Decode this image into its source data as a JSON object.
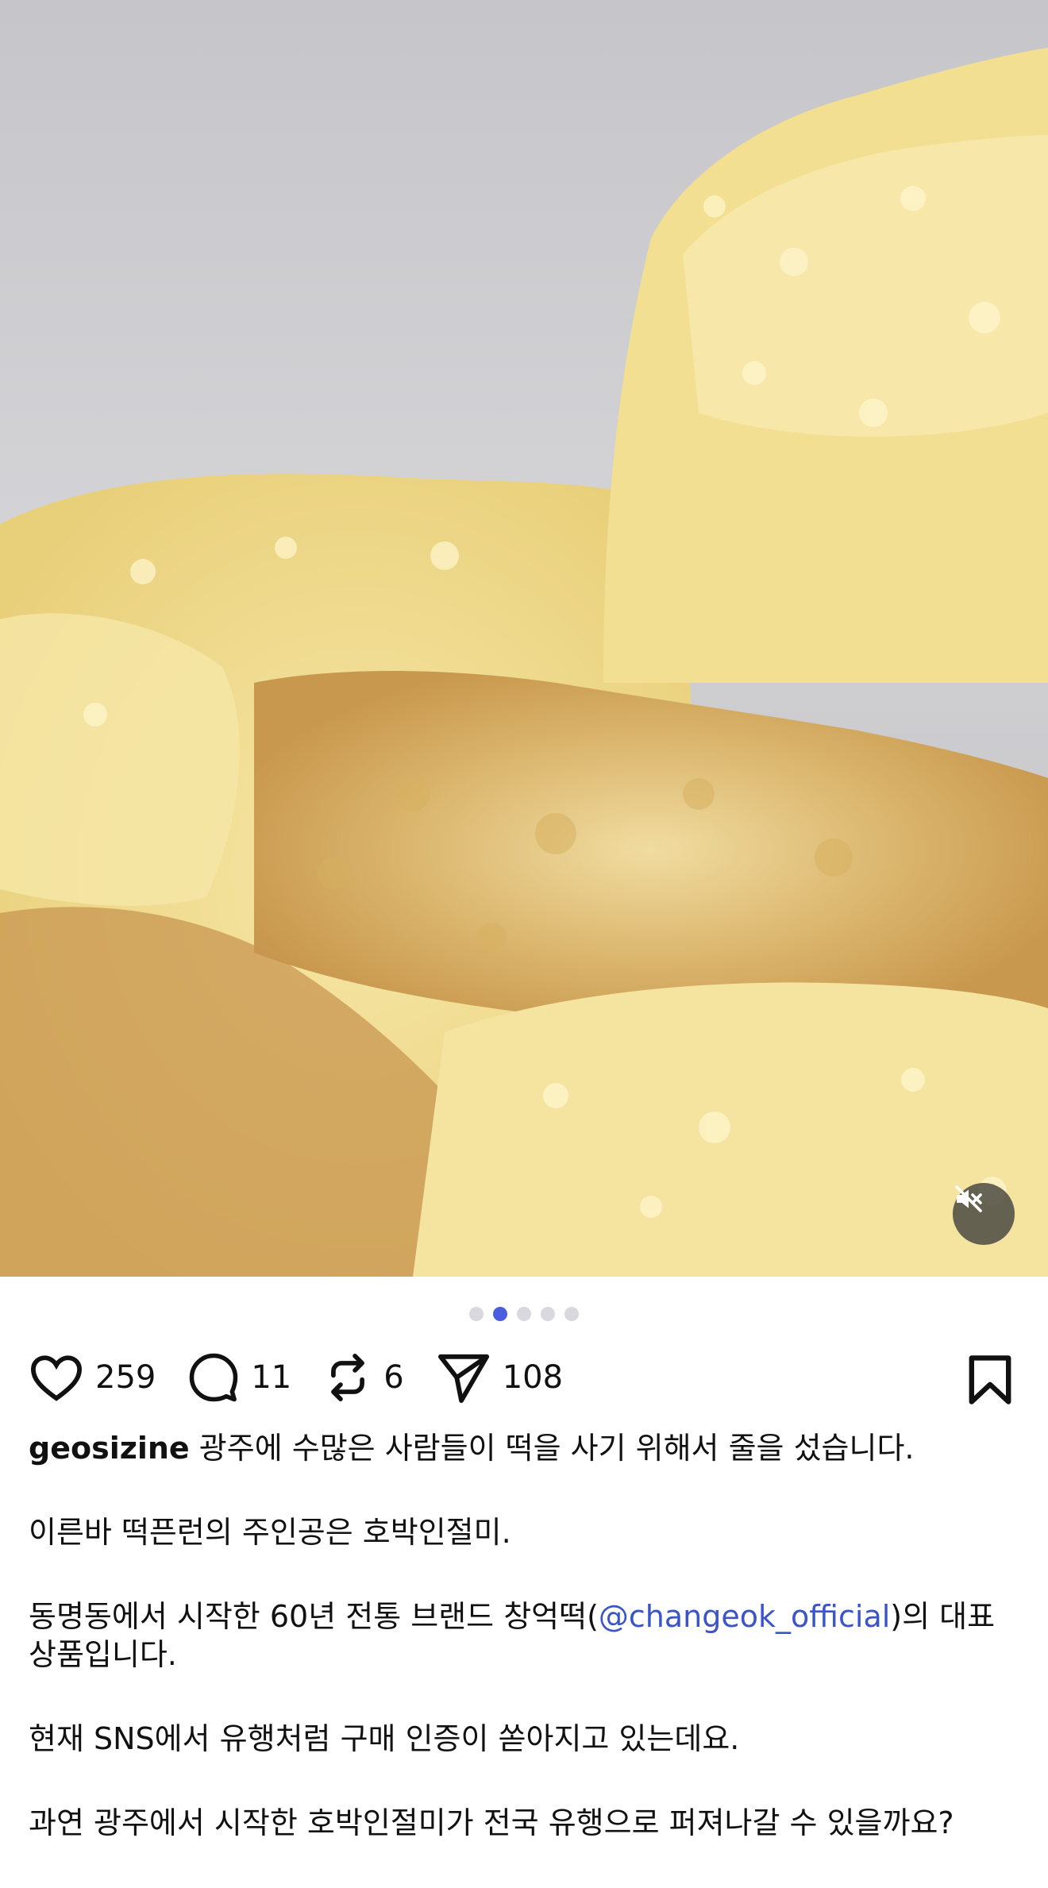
{
  "media": {
    "carousel_count": 5,
    "active_index": 1,
    "mute_icon": "speaker-muted-icon"
  },
  "actions": {
    "like_count": "259",
    "comment_count": "11",
    "repost_count": "6",
    "share_count": "108",
    "like_icon": "heart-icon",
    "comment_icon": "speech-bubble-icon",
    "repost_icon": "repost-arrows-icon",
    "share_icon": "send-icon",
    "bookmark_icon": "bookmark-icon"
  },
  "caption": {
    "username": "geosizine",
    "line1": " 광주에 수많은 사람들이 떡을 사기 위해서 줄을 섰습니다.",
    "line2": "이른바 떡픈런의 주인공은 호박인절미.",
    "line3_pre": "동명동에서 시작한 60년 전통 브랜드 창억떡(",
    "line3_mention": "@changeok_official",
    "line3_post": ")의 대표 상품입니다.",
    "line4": "현재 SNS에서 유행처럼 구매 인증이 쏟아지고 있는데요.",
    "line5": "과연 광주에서 시작한 호박인절미가 전국 유행으로 퍼져나갈 수 있을까요?"
  },
  "colors": {
    "accent_dot": "#4a5ee0",
    "mention": "#3b55c9",
    "text": "#111111"
  }
}
